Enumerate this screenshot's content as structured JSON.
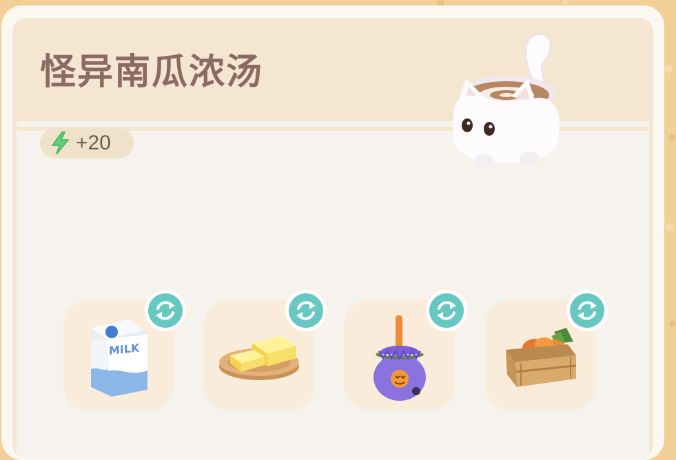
{
  "recipe": {
    "title": "怪异南瓜浓汤",
    "energy_bonus": "+20",
    "energy_icon": "lightning-icon",
    "mascot_icon": "cat-cup-icon"
  },
  "ingredients": [
    {
      "name": "milk",
      "icon": "milk-carton-icon",
      "carton_text": "MILK"
    },
    {
      "name": "butter",
      "icon": "butter-icon"
    },
    {
      "name": "halloween-candy",
      "icon": "candy-bag-icon"
    },
    {
      "name": "pumpkins",
      "icon": "pumpkin-crate-icon"
    }
  ],
  "swap_icon": "swap-icon",
  "colors": {
    "background": "#f1cf96",
    "header": "#f5e6d1",
    "title": "#8b6a63",
    "swap_button": "#67c8c2",
    "slot": "#f9ecda"
  }
}
